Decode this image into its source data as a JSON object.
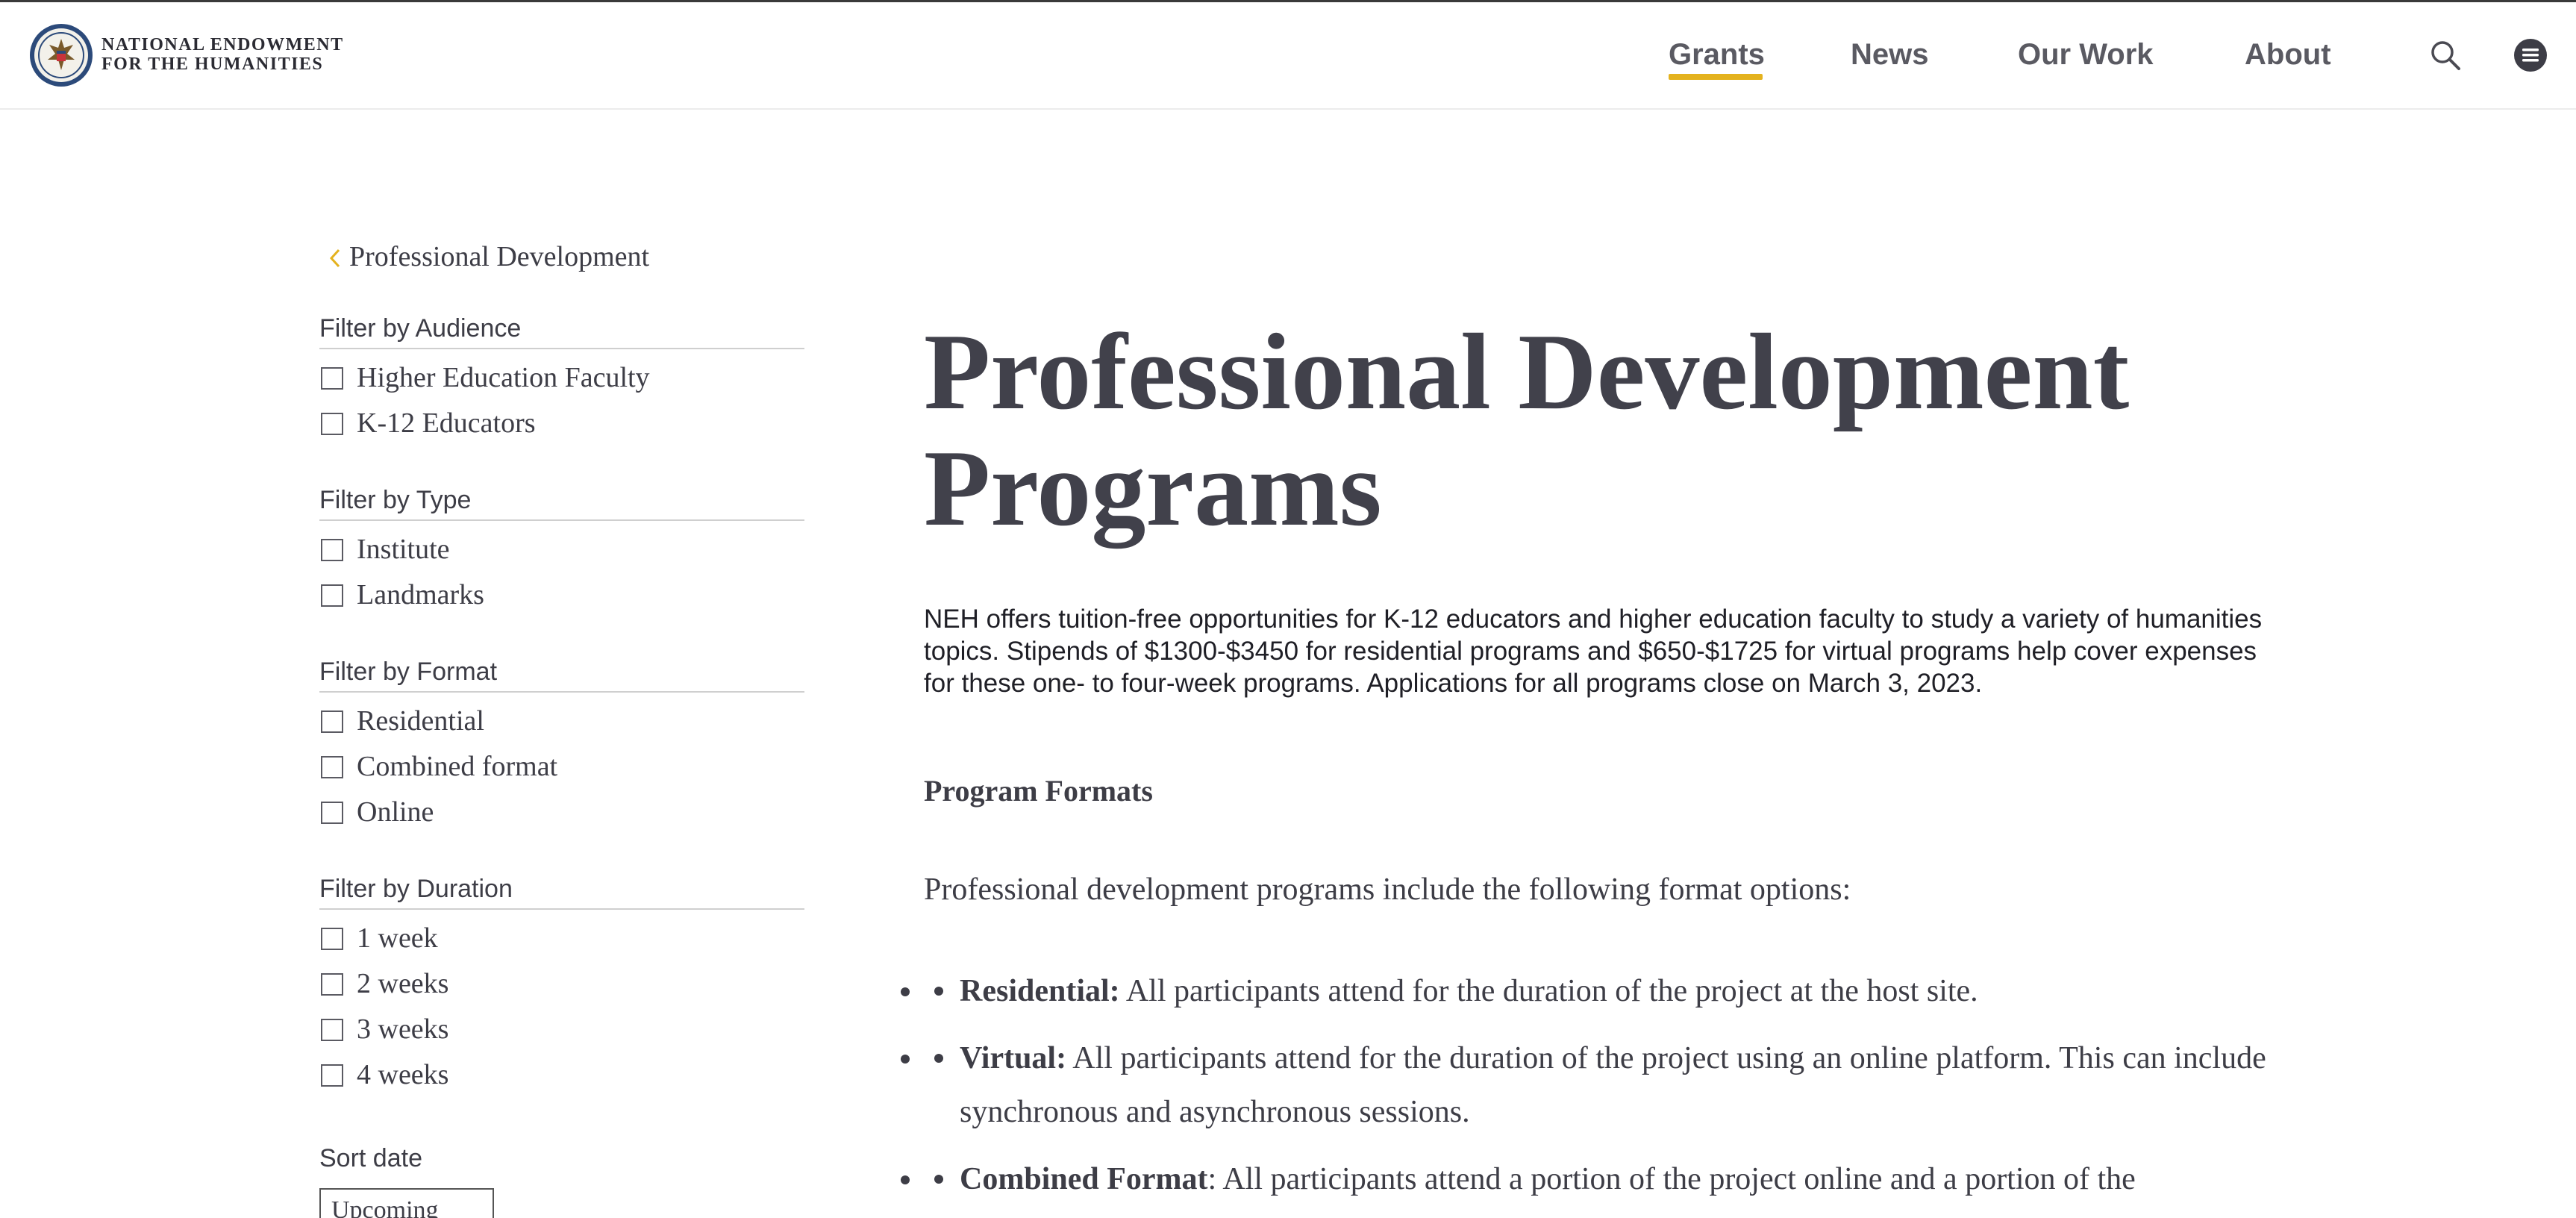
{
  "header": {
    "logo_line1": "NATIONAL ENDOWMENT",
    "logo_line2": "FOR THE HUMANITIES",
    "nav": [
      {
        "label": "Grants",
        "active": true
      },
      {
        "label": "News"
      },
      {
        "label": "Our Work"
      },
      {
        "label": "About"
      }
    ],
    "icons": [
      "search-icon",
      "menu-icon"
    ],
    "accent_color": "#e4b21e"
  },
  "sidebar": {
    "back_link": "Professional Development",
    "filters": [
      {
        "heading": "Filter by Audience",
        "options": [
          "Higher Education Faculty",
          "K-12 Educators"
        ]
      },
      {
        "heading": "Filter by Type",
        "options": [
          "Institute",
          "Landmarks"
        ]
      },
      {
        "heading": "Filter by Format",
        "options": [
          "Residential",
          "Combined format",
          "Online"
        ]
      },
      {
        "heading": "Filter by Duration",
        "options": [
          "1 week",
          "2 weeks",
          "3 weeks",
          "4 weeks"
        ]
      }
    ],
    "sort_label": "Sort date",
    "sort_value": "Upcoming"
  },
  "main": {
    "title_line1": "Professional Development",
    "title_line2": "Programs",
    "intro": "NEH offers tuition-free opportunities for K-12 educators and higher education faculty to study a variety of humanities topics. Stipends of $1300-$3450 for residential programs and $650-$1725 for virtual programs help cover expenses for these one- to four-week programs. Applications for all programs close on March 3, 2023.",
    "subheading": "Program Formats",
    "paragraph": "Professional development programs include the following format options:",
    "bullets": [
      {
        "term": "Residential:",
        "text": " All participants attend for the duration of the project at the host site."
      },
      {
        "term": "Virtual:",
        "text": " All participants attend for the duration of the project using an online platform. This can include synchronous and asynchronous sessions."
      },
      {
        "term": "Combined Format",
        "text": ": All participants attend a portion of the project online and a portion of the"
      }
    ]
  }
}
